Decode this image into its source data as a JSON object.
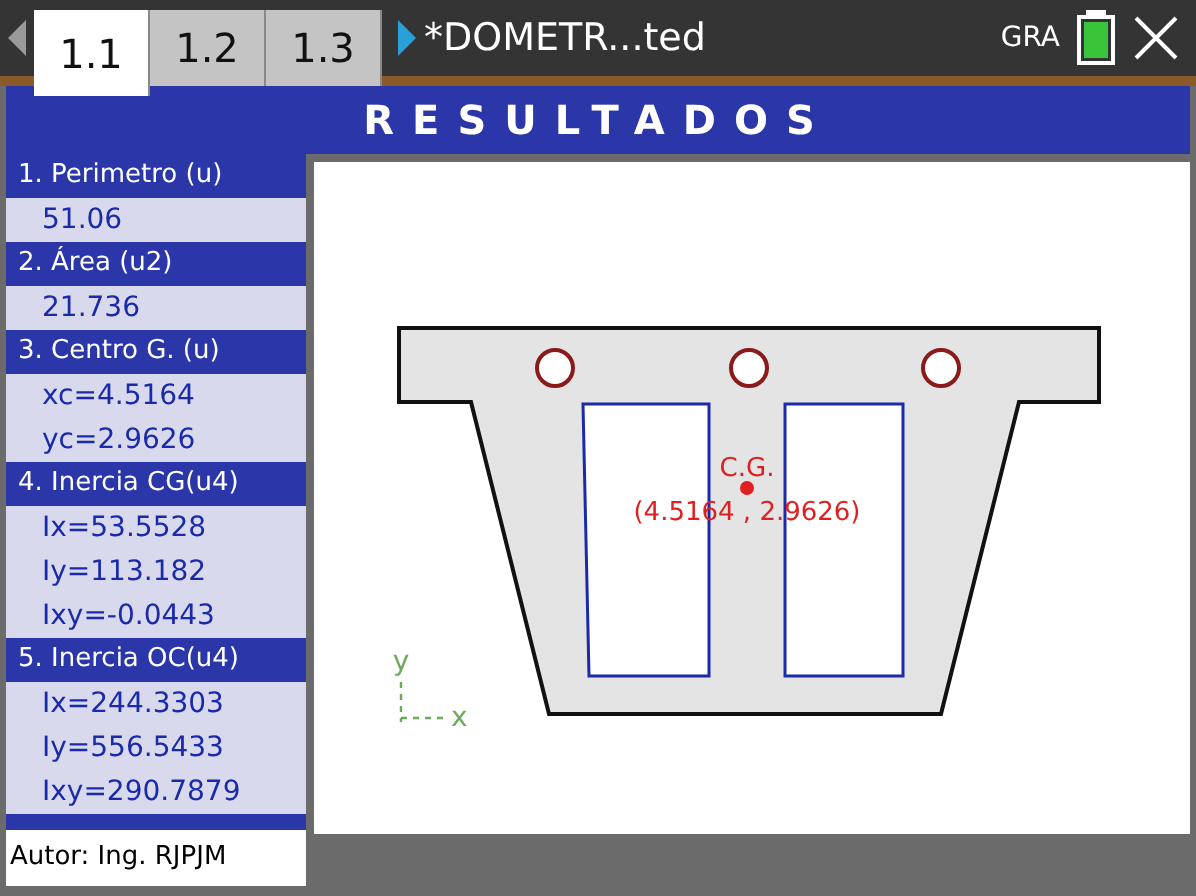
{
  "tabs": [
    {
      "label": "1.1",
      "selected": true
    },
    {
      "label": "1.2",
      "selected": false
    },
    {
      "label": "1.3",
      "selected": false
    }
  ],
  "document_title": "*DOMETR...ted",
  "status": {
    "mode": "GRA"
  },
  "header": {
    "title": "RESULTADOS"
  },
  "sections": [
    {
      "title": "1. Perimetro (u)",
      "values": [
        "51.06"
      ]
    },
    {
      "title": "2. Área (u2)",
      "values": [
        "21.736"
      ]
    },
    {
      "title": "3. Centro G. (u)",
      "values": [
        "xc=4.5164",
        "yc=2.9626"
      ]
    },
    {
      "title": "4. Inercia CG(u4)",
      "values": [
        "Ix=53.5528",
        "Iy=113.182",
        "Ixy=-0.0443"
      ]
    },
    {
      "title": "5. Inercia OC(u4)",
      "values": [
        "Ix=244.3303",
        "Iy=556.5433",
        "Ixy=290.7879"
      ]
    }
  ],
  "author": "Autor: Ing. RJPJM",
  "drawing": {
    "cg_label": "C.G.",
    "cg_coords": "(4.5164 , 2.9626)",
    "axis_y": "y",
    "axis_x": "x"
  }
}
